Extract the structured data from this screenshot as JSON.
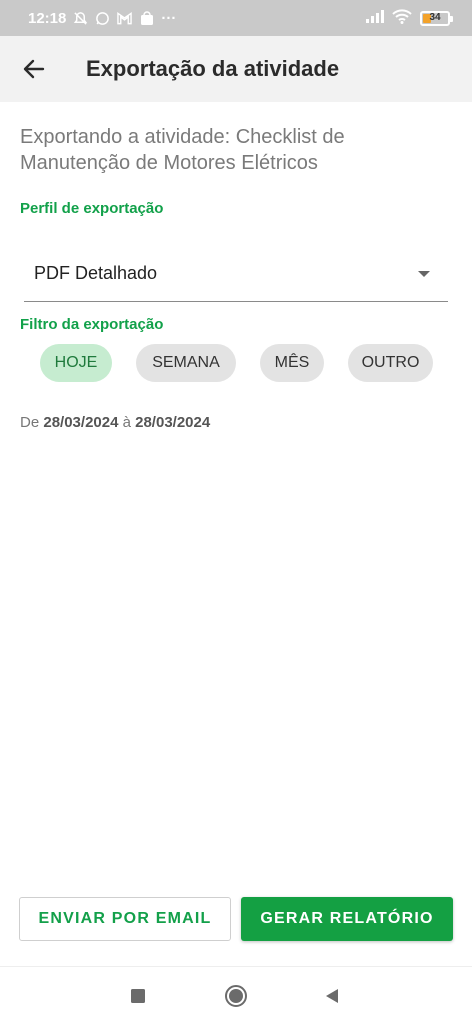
{
  "status_bar": {
    "time": "12:18",
    "more": "···",
    "battery_level": "34",
    "icons": [
      "mute-icon",
      "whatsapp-icon",
      "gmail-icon",
      "shop-icon",
      "signal-icon",
      "wifi-icon",
      "battery-icon"
    ]
  },
  "app_bar": {
    "title": "Exportação da atividade",
    "back_icon": "arrow-left-icon"
  },
  "content": {
    "subtitle": "Exportando a atividade: Checklist de Manutenção de Motores Elétricos",
    "profile_label": "Perfil de exportação",
    "profile_value": "PDF Detalhado",
    "filter_label": "Filtro da exportação",
    "chips": [
      {
        "label": "HOJE",
        "selected": true
      },
      {
        "label": "SEMANA",
        "selected": false
      },
      {
        "label": "MÊS",
        "selected": false
      },
      {
        "label": "OUTRO",
        "selected": false
      }
    ],
    "date_range": {
      "prefix": "De",
      "start": "28/03/2024",
      "separator": "à",
      "end": "28/03/2024"
    }
  },
  "actions": {
    "email_label": "ENVIAR POR EMAIL",
    "report_label": "GERAR RELATÓRIO"
  },
  "colors": {
    "accent_green": "#14a043",
    "chip_selected_bg": "#c6ecd0",
    "app_bar_bg": "#f2f2f2",
    "status_bar_bg": "#c9c9c9"
  }
}
